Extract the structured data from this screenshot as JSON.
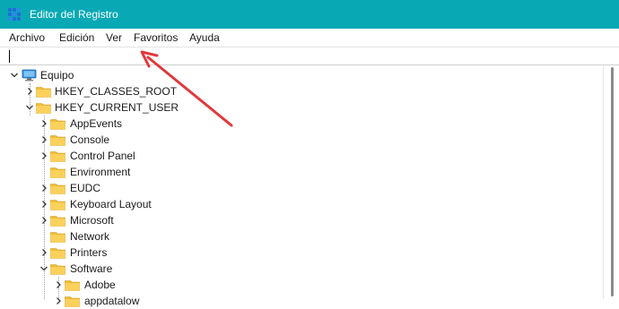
{
  "window": {
    "title": "Editor del Registro",
    "accent_color": "#08a9b5",
    "app_icon": "registry-editor-icon"
  },
  "menu": {
    "items": [
      "Archivo",
      "Edición",
      "Ver",
      "Favoritos",
      "Ayuda"
    ]
  },
  "address": {
    "value": ""
  },
  "tree": {
    "root": "Equipo",
    "nodes": [
      {
        "label": "HKEY_CLASSES_ROOT",
        "expander": "collapsed"
      },
      {
        "label": "HKEY_CURRENT_USER",
        "expander": "expanded"
      },
      {
        "label": "AppEvents",
        "expander": "collapsed"
      },
      {
        "label": "Console",
        "expander": "collapsed"
      },
      {
        "label": "Control Panel",
        "expander": "collapsed"
      },
      {
        "label": "Environment",
        "expander": "none"
      },
      {
        "label": "EUDC",
        "expander": "collapsed"
      },
      {
        "label": "Keyboard Layout",
        "expander": "collapsed"
      },
      {
        "label": "Microsoft",
        "expander": "collapsed"
      },
      {
        "label": "Network",
        "expander": "none"
      },
      {
        "label": "Printers",
        "expander": "collapsed"
      },
      {
        "label": "Software",
        "expander": "expanded"
      },
      {
        "label": "Adobe",
        "expander": "collapsed"
      },
      {
        "label": "appdatalow",
        "expander": "collapsed"
      }
    ]
  },
  "annotation": {
    "arrow_color": "#e0393e"
  }
}
